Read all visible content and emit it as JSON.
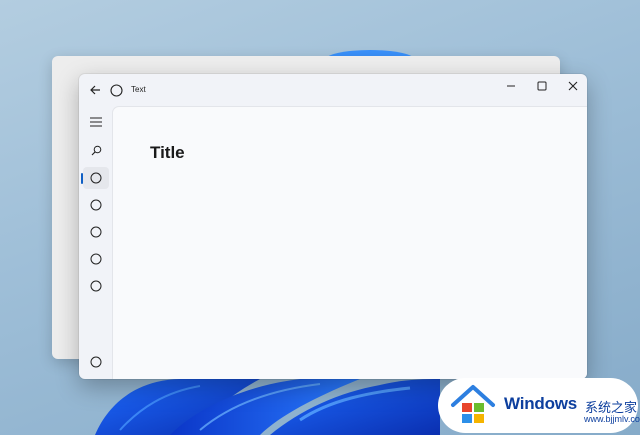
{
  "window": {
    "title": "Text",
    "page_title": "Title"
  },
  "titlebar": {
    "icons": [
      "back-arrow-icon",
      "app-circle-icon",
      "minimize-icon",
      "maximize-icon",
      "close-icon"
    ]
  },
  "nav_rail": {
    "items": [
      "menu-icon",
      "search-icon",
      "circle-icon",
      "circle-icon",
      "circle-icon",
      "circle-icon",
      "circle-icon"
    ],
    "selected_index": 2,
    "footer_item": "circle-icon"
  },
  "watermark": {
    "brand": "Windows",
    "subtitle_cn": "系统之家",
    "url": "www.bjjmlv.com"
  },
  "colors": {
    "accent": "#0f5fc4",
    "window_bg": "#f1f3f8",
    "content_bg": "#f9fafc",
    "watermark_text": "#0d3f9e"
  }
}
